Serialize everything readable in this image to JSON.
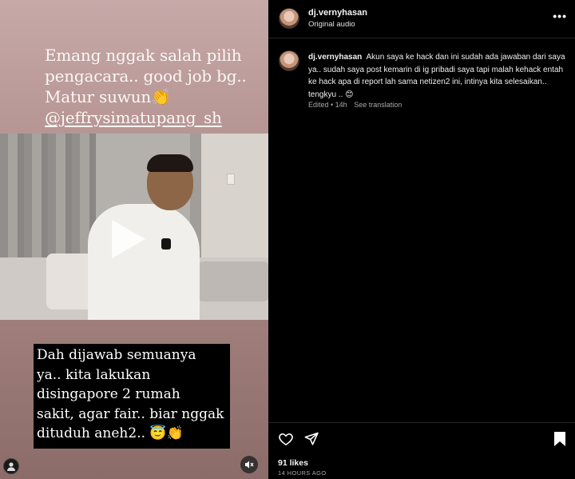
{
  "media": {
    "caption_top_lines": [
      "Emang nggak salah pilih",
      "pengacara.. good job bg..",
      "Matur suwun👏"
    ],
    "caption_top_handle": "@jeffrysimatupang_sh",
    "caption_bottom_lines": [
      "Dah dijawab semuanya",
      "ya.. kita lakukan",
      "disingapore 2 rumah",
      "sakit, agar fair.. biar nggak",
      "dituduh aneh2.. 😇👏"
    ],
    "play_icon": "play-icon",
    "mute_icon": "speaker-muted-icon",
    "profile_icon": "user-icon"
  },
  "header": {
    "username": "dj.vernyhasan",
    "audio_label": "Original audio",
    "more_icon": "more-horizontal-icon",
    "more_label": "•••"
  },
  "comment": {
    "username": "dj.vernyhasan",
    "text": "Akun saya ke hack dan ini sudah ada jawaban dari saya ya.. sudah saya post kemarin di ig pribadi saya tapi malah kehack entah ke hack apa di report lah sama netizen2 ini, intinya kita selesaikan.. tengkyu .. 😊",
    "edited": "Edited • 14h",
    "see_translation": "See translation"
  },
  "actions": {
    "like_icon": "heart-icon",
    "share_icon": "paper-plane-icon",
    "save_icon": "bookmark-icon",
    "likes": "91 likes",
    "time_ago": "14 HOURS AGO"
  }
}
